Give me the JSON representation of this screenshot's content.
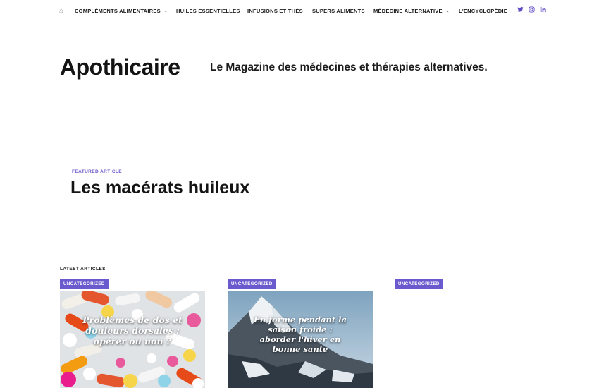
{
  "nav": {
    "home_icon": "⌂",
    "items": [
      {
        "label": "COMPLÉMENTS ALIMENTAIRES",
        "has_dropdown": true
      },
      {
        "label": "HUILES ESSENTIELLES",
        "has_dropdown": false
      },
      {
        "label": "INFUSIONS ET THÉS",
        "has_dropdown": false
      },
      {
        "label": "SUPERS ALIMENTS",
        "has_dropdown": false
      },
      {
        "label": "MÉDECINE ALTERNATIVE",
        "has_dropdown": true
      },
      {
        "label": "L'ENCYCLOPÉDIE",
        "has_dropdown": false
      }
    ],
    "social": [
      "twitter-icon",
      "instagram-icon",
      "linkedin-icon"
    ]
  },
  "brand": {
    "name": "Apothicaire",
    "tagline": "Le Magazine des médecines et thérapies alternatives."
  },
  "featured": {
    "kicker": "FEATURED ARTICLE",
    "title": "Les macérats huileux"
  },
  "latest": {
    "heading": "LATEST ARTICLES",
    "articles": [
      {
        "category": "UNCATEGORIZED",
        "image_text": "Problèmes de dos et douleurs dorsales : opérer ou non ?"
      },
      {
        "category": "UNCATEGORIZED",
        "image_text": "En forme pendant la saison froide : aborder l'hiver en bonne santé"
      },
      {
        "category": "UNCATEGORIZED",
        "image_text": ""
      }
    ]
  },
  "colors": {
    "accent": "#6a5acd",
    "text": "#161616"
  }
}
